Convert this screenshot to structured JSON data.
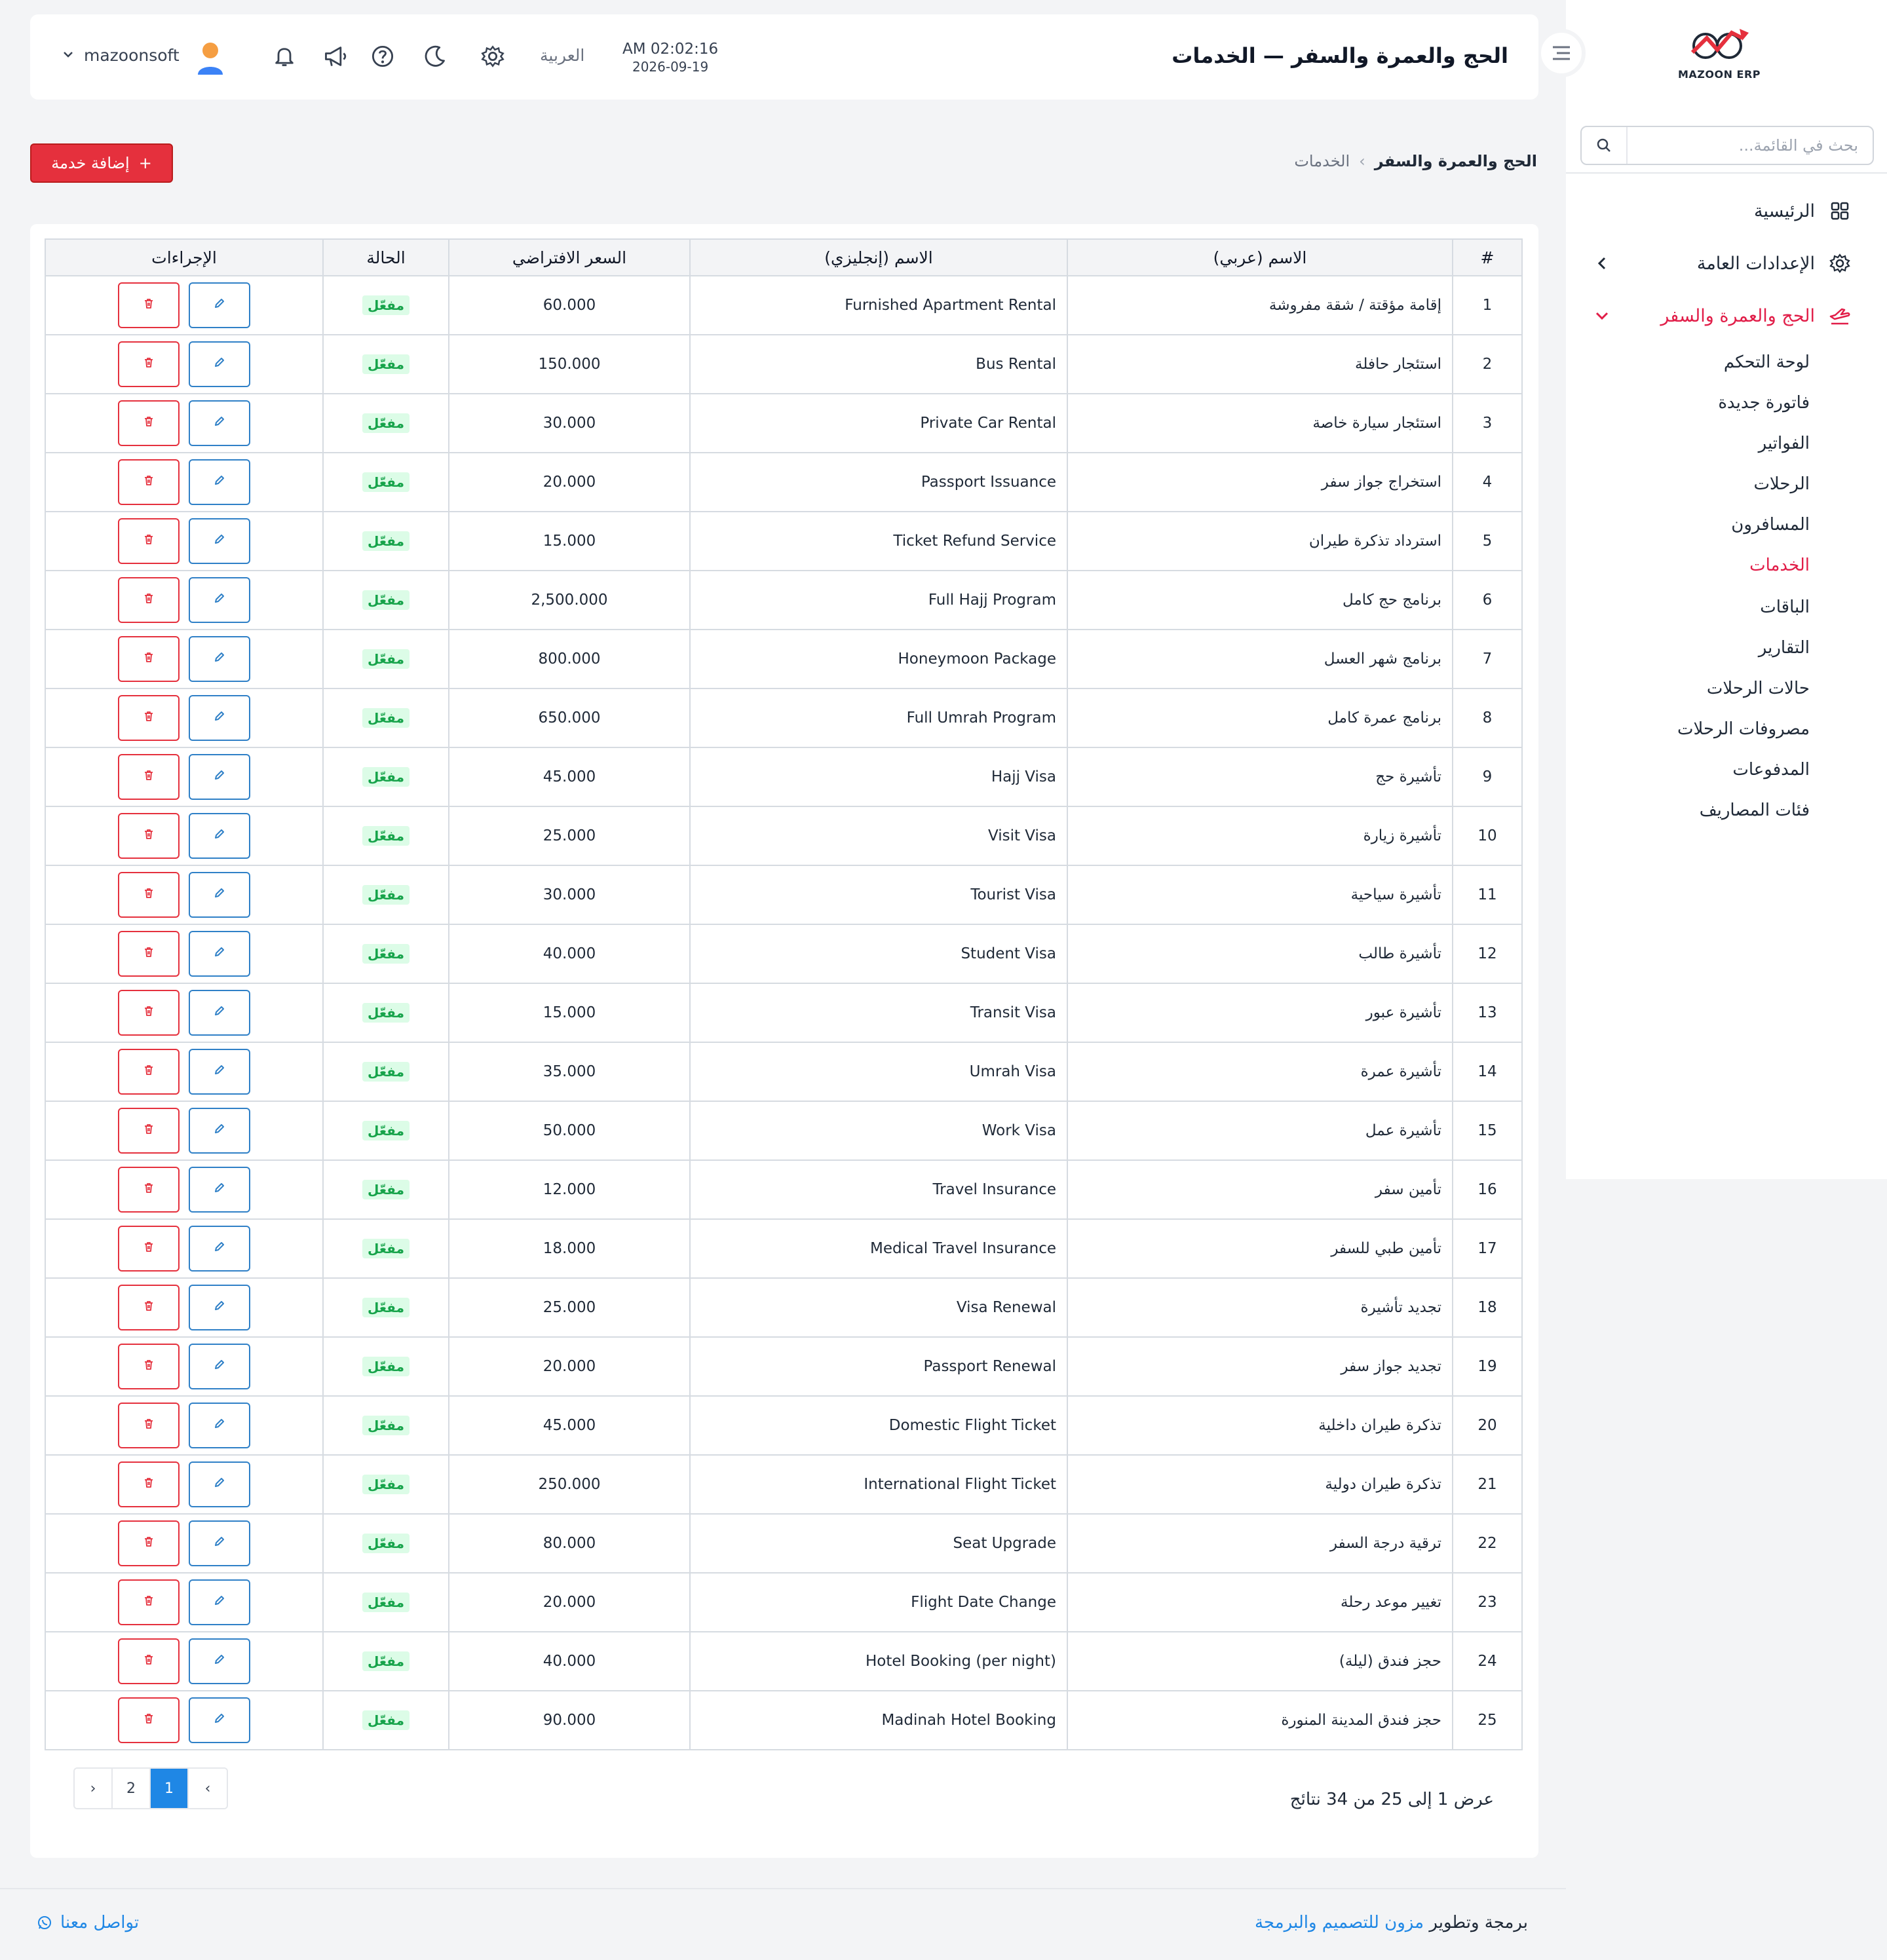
{
  "brand": {
    "name": "MAZOON ERP"
  },
  "sidebar": {
    "search_placeholder": "بحث في القائمة...",
    "menu": [
      {
        "label": "الرئيسية",
        "icon": "grid-icon"
      },
      {
        "label": "الإعدادات العامة",
        "icon": "gear-icon"
      },
      {
        "label": "الحج والعمرة والسفر",
        "icon": "plane-icon",
        "active": true
      }
    ],
    "submenu": [
      "لوحة التحكم",
      "فاتورة جديدة",
      "الفواتير",
      "الرحلات",
      "المسافرون",
      "الخدمات",
      "الباقات",
      "التقارير",
      "حالات الرحلات",
      "مصروفات الرحلات",
      "المدفوعات",
      "فئات المصاريف"
    ],
    "submenu_active_index": 5
  },
  "header": {
    "title": "الحج والعمرة والسفر — الخدمات",
    "time": "AM 02:02:16",
    "date": "2026-09-19",
    "language": "العربية",
    "username": "mazoonsoft"
  },
  "breadcrumb": {
    "parent": "الحج والعمرة والسفر",
    "separator": "›",
    "current": "الخدمات"
  },
  "add_button": {
    "icon": "+",
    "label": "إضافة خدمة"
  },
  "table": {
    "headers": [
      "#",
      "الاسم (عربي)",
      "الاسم (إنجليزي)",
      "السعر الافتراضي",
      "الحالة",
      "الإجراءات"
    ],
    "status_label": "مفعّل",
    "rows": [
      {
        "n": "1",
        "ar": "إقامة مؤقتة / شقة مفروشة",
        "en": "Furnished Apartment Rental",
        "price": "60.000"
      },
      {
        "n": "2",
        "ar": "استئجار حافلة",
        "en": "Bus Rental",
        "price": "150.000"
      },
      {
        "n": "3",
        "ar": "استئجار سيارة خاصة",
        "en": "Private Car Rental",
        "price": "30.000"
      },
      {
        "n": "4",
        "ar": "استخراج جواز سفر",
        "en": "Passport Issuance",
        "price": "20.000"
      },
      {
        "n": "5",
        "ar": "استرداد تذكرة طيران",
        "en": "Ticket Refund Service",
        "price": "15.000"
      },
      {
        "n": "6",
        "ar": "برنامج حج كامل",
        "en": "Full Hajj Program",
        "price": "2,500.000"
      },
      {
        "n": "7",
        "ar": "برنامج شهر العسل",
        "en": "Honeymoon Package",
        "price": "800.000"
      },
      {
        "n": "8",
        "ar": "برنامج عمرة كامل",
        "en": "Full Umrah Program",
        "price": "650.000"
      },
      {
        "n": "9",
        "ar": "تأشيرة حج",
        "en": "Hajj Visa",
        "price": "45.000"
      },
      {
        "n": "10",
        "ar": "تأشيرة زيارة",
        "en": "Visit Visa",
        "price": "25.000"
      },
      {
        "n": "11",
        "ar": "تأشيرة سياحية",
        "en": "Tourist Visa",
        "price": "30.000"
      },
      {
        "n": "12",
        "ar": "تأشيرة طالب",
        "en": "Student Visa",
        "price": "40.000"
      },
      {
        "n": "13",
        "ar": "تأشيرة عبور",
        "en": "Transit Visa",
        "price": "15.000"
      },
      {
        "n": "14",
        "ar": "تأشيرة عمرة",
        "en": "Umrah Visa",
        "price": "35.000"
      },
      {
        "n": "15",
        "ar": "تأشيرة عمل",
        "en": "Work Visa",
        "price": "50.000"
      },
      {
        "n": "16",
        "ar": "تأمين سفر",
        "en": "Travel Insurance",
        "price": "12.000"
      },
      {
        "n": "17",
        "ar": "تأمين طبي للسفر",
        "en": "Medical Travel Insurance",
        "price": "18.000"
      },
      {
        "n": "18",
        "ar": "تجديد تأشيرة",
        "en": "Visa Renewal",
        "price": "25.000"
      },
      {
        "n": "19",
        "ar": "تجديد جواز سفر",
        "en": "Passport Renewal",
        "price": "20.000"
      },
      {
        "n": "20",
        "ar": "تذكرة طيران داخلية",
        "en": "Domestic Flight Ticket",
        "price": "45.000"
      },
      {
        "n": "21",
        "ar": "تذكرة طيران دولية",
        "en": "International Flight Ticket",
        "price": "250.000"
      },
      {
        "n": "22",
        "ar": "ترقية درجة السفر",
        "en": "Seat Upgrade",
        "price": "80.000"
      },
      {
        "n": "23",
        "ar": "تغيير موعد رحلة",
        "en": "Flight Date Change",
        "price": "20.000"
      },
      {
        "n": "24",
        "ar": "حجز فندق (ليلة)",
        "en": "Hotel Booking (per night)",
        "price": "40.000"
      },
      {
        "n": "25",
        "ar": "حجز فندق المدينة المنورة",
        "en": "Madinah Hotel Booking",
        "price": "90.000"
      }
    ]
  },
  "pagination": {
    "info": "عرض 1 إلى 25 من 34 نتائج",
    "prev": "‹",
    "pages": [
      "1",
      "2"
    ],
    "next": "›",
    "active_page": "1"
  },
  "footer": {
    "credit_prefix": "برمجة وتطوير",
    "credit_link": "مزون للتصميم والبرمجة",
    "contact": "تواصل معنا"
  },
  "colors": {
    "accent_red": "#e5303d",
    "accent_blue": "#1f87e5",
    "status_green": "#16a34a"
  }
}
